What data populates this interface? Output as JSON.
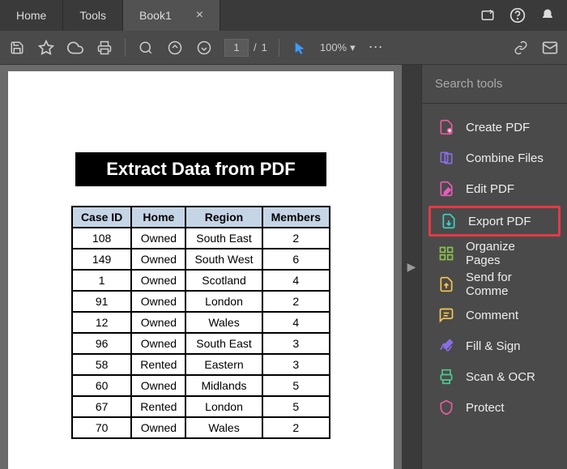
{
  "tabs": {
    "home": "Home",
    "tools": "Tools",
    "active": "Book1"
  },
  "toolbar": {
    "current_page": "1",
    "page_sep": "/",
    "total_pages": "1",
    "zoom": "100%"
  },
  "document": {
    "title": "Extract Data from PDF",
    "columns": [
      "Case ID",
      "Home",
      "Region",
      "Members"
    ],
    "rows": [
      [
        "108",
        "Owned",
        "South East",
        "2"
      ],
      [
        "149",
        "Owned",
        "South West",
        "6"
      ],
      [
        "1",
        "Owned",
        "Scotland",
        "4"
      ],
      [
        "91",
        "Owned",
        "London",
        "2"
      ],
      [
        "12",
        "Owned",
        "Wales",
        "4"
      ],
      [
        "96",
        "Owned",
        "South East",
        "3"
      ],
      [
        "58",
        "Rented",
        "Eastern",
        "3"
      ],
      [
        "60",
        "Owned",
        "Midlands",
        "5"
      ],
      [
        "67",
        "Rented",
        "London",
        "5"
      ],
      [
        "70",
        "Owned",
        "Wales",
        "2"
      ]
    ]
  },
  "sidebar": {
    "search_placeholder": "Search tools",
    "items": [
      {
        "label": "Create PDF",
        "color": "#e85d9e",
        "icon": "create"
      },
      {
        "label": "Combine Files",
        "color": "#8a6de8",
        "icon": "combine"
      },
      {
        "label": "Edit PDF",
        "color": "#e85dbb",
        "icon": "edit"
      },
      {
        "label": "Export PDF",
        "color": "#3bd4c4",
        "icon": "export",
        "highlighted": true
      },
      {
        "label": "Organize Pages",
        "color": "#8bc34a",
        "icon": "organize"
      },
      {
        "label": "Send for Comme",
        "color": "#f9c74f",
        "icon": "send"
      },
      {
        "label": "Comment",
        "color": "#f9c74f",
        "icon": "comment"
      },
      {
        "label": "Fill & Sign",
        "color": "#8a6de8",
        "icon": "sign"
      },
      {
        "label": "Scan & OCR",
        "color": "#4fc98f",
        "icon": "scan"
      },
      {
        "label": "Protect",
        "color": "#e85d9e",
        "icon": "protect"
      }
    ]
  }
}
